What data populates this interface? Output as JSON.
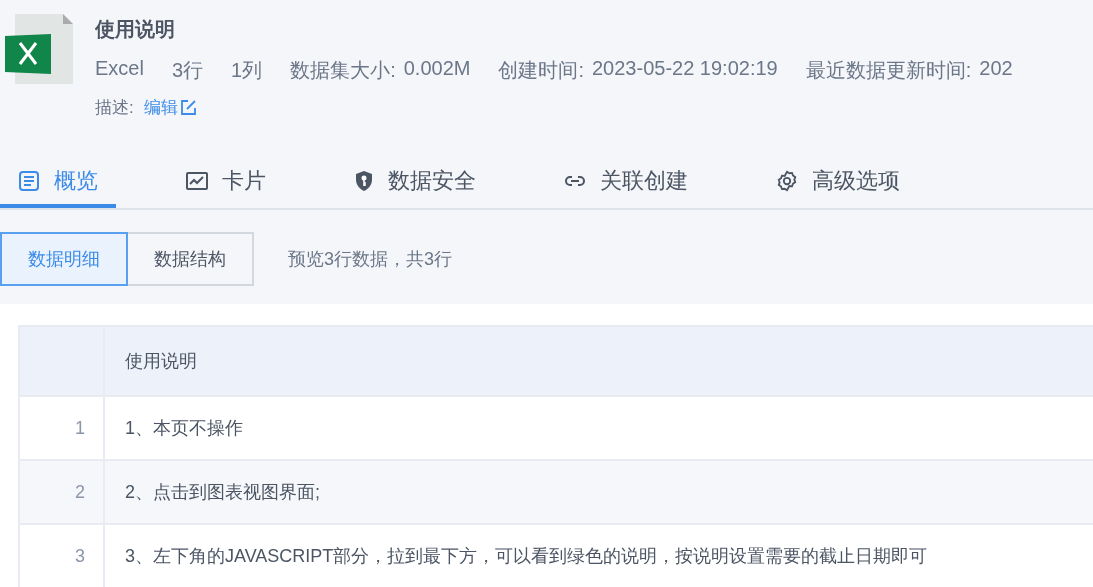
{
  "dataset": {
    "title": "使用说明",
    "type": "Excel",
    "rows": "3行",
    "columns": "1列",
    "meta": [
      {
        "label": "数据集大小:",
        "value": "0.002M"
      },
      {
        "label": "创建时间:",
        "value": "2023-05-22 19:02:19"
      },
      {
        "label": "最近数据更新时间:",
        "value": "202"
      }
    ],
    "description_label": "描述:",
    "edit_link": "编辑"
  },
  "tabs": [
    {
      "label": "概览",
      "selected": true
    },
    {
      "label": "卡片",
      "selected": false
    },
    {
      "label": "数据安全",
      "selected": false
    },
    {
      "label": "关联创建",
      "selected": false
    },
    {
      "label": "高级选项",
      "selected": false
    }
  ],
  "subtabs": [
    {
      "label": "数据明细",
      "selected": true
    },
    {
      "label": "数据结构",
      "selected": false
    }
  ],
  "preview_note": "预览3行数据，共3行",
  "table": {
    "columns": [
      "使用说明"
    ],
    "rows": [
      {
        "index": "1",
        "cells": [
          "1、本页不操作"
        ]
      },
      {
        "index": "2",
        "cells": [
          "2、点击到图表视图界面;"
        ]
      },
      {
        "index": "3",
        "cells": [
          "3、左下角的JAVASCRIPT部分，拉到最下方，可以看到绿色的说明，按说明设置需要的截止日期即可"
        ]
      }
    ]
  }
}
